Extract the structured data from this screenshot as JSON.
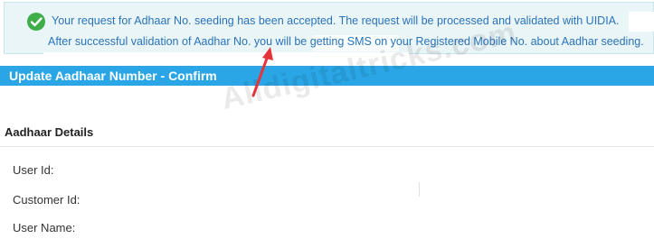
{
  "alert": {
    "line1": "Your request for Adhaar No. seeding has been accepted. The request will be processed and validated with UIDIA.",
    "line2": "After successful validation of Aadhar No. you will be getting SMS on your Registered Mobile No. about Aadhar seeding."
  },
  "header": {
    "title": "Update Aadhaar Number - Confirm"
  },
  "details": {
    "section_title": "Aadhaar Details",
    "user_id_label": "User Id:",
    "customer_id_label": "Customer Id:",
    "user_name_label": "User Name:"
  },
  "watermark": {
    "text": "Alldigitaltricks.com"
  },
  "colors": {
    "alert_text": "#2a73b8",
    "header_bar": "#2aa6e6",
    "success_icon": "#3fae49",
    "annotation_arrow": "#e5333a"
  }
}
